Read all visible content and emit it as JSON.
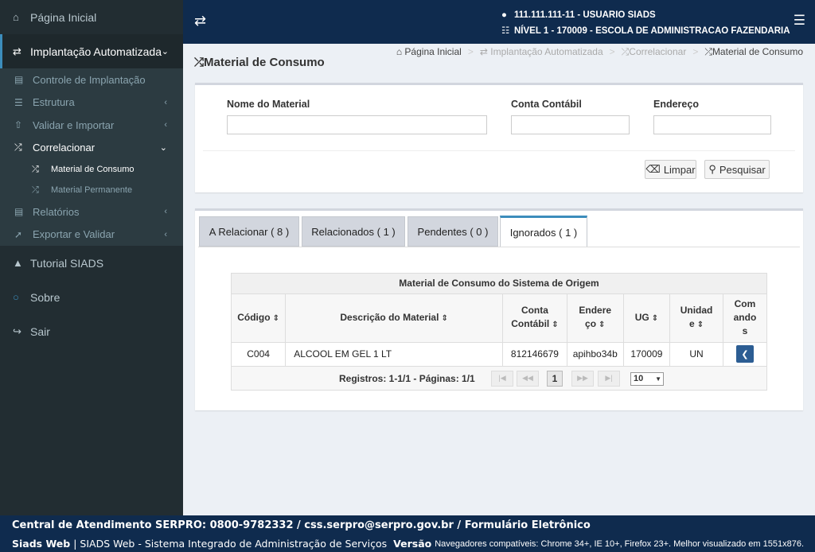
{
  "sidebar": {
    "home": "Página Inicial",
    "impl": "Implantação Automatizada",
    "sub": {
      "controle": "Controle de Implantação",
      "estrutura": "Estrutura",
      "validar": "Validar e Importar",
      "correlacionar": "Correlacionar",
      "consumo": "Material de Consumo",
      "permanente": "Material Permanente",
      "relatorios": "Relatórios",
      "exportar": "Exportar e Validar"
    },
    "tutorial": "Tutorial SIADS",
    "sobre": "Sobre",
    "sair": "Sair"
  },
  "header": {
    "user": "111.111.111-11 - USUARIO SIADS",
    "level": "NÍVEL 1 - 170009 - ESCOLA DE ADMINISTRACAO FAZENDARIA"
  },
  "page": {
    "title": "Material de Consumo",
    "breadcrumb": [
      "Página Inicial",
      "Implantação Automatizada",
      "Correlacionar",
      "Material de Consumo"
    ]
  },
  "search": {
    "nome_label": "Nome do Material",
    "conta_label": "Conta Contábil",
    "endereco_label": "Endereço",
    "nome_value": "",
    "conta_value": "",
    "endereco_value": "",
    "limpar": "Limpar",
    "pesquisar": "Pesquisar"
  },
  "tabs": [
    {
      "label": "A Relacionar ( 8 )"
    },
    {
      "label": "Relacionados ( 1 )"
    },
    {
      "label": "Pendentes ( 0 )"
    },
    {
      "label": "Ignorados ( 1 )"
    }
  ],
  "grid": {
    "caption": "Material de Consumo do Sistema de Origem",
    "headers": {
      "codigo": "Código",
      "descricao": "Descrição do Material",
      "conta1": "Conta",
      "conta2": "Contábil",
      "end1": "Endere",
      "end2": "ço",
      "ug": "UG",
      "unid1": "Unidad",
      "unid2": "e",
      "cmd1": "Com",
      "cmd2": "ando",
      "cmd3": "s"
    },
    "rows": [
      {
        "codigo": "C004",
        "descricao": "ALCOOL EM GEL 1 LT",
        "conta": "812146679",
        "endereco": "apihbo34b",
        "ug": "170009",
        "unidade": "UN"
      }
    ],
    "pager_info": "Registros: 1-1/1 - Páginas: 1/1",
    "current_page": "1",
    "page_size": "10"
  },
  "footer": {
    "line1": "Central de Atendimento SERPRO: 0800-9782332 / css.serpro@serpro.gov.br / Formulário Eletrônico",
    "brand": "Siads Web",
    "line2": "| SIADS Web - Sistema Integrado de Administração de Serviços",
    "versao": "Versão",
    "browsers": "Navegadores compatíveis: Chrome 34+, IE 10+, Firefox 23+. Melhor visualizado em 1551x876."
  }
}
